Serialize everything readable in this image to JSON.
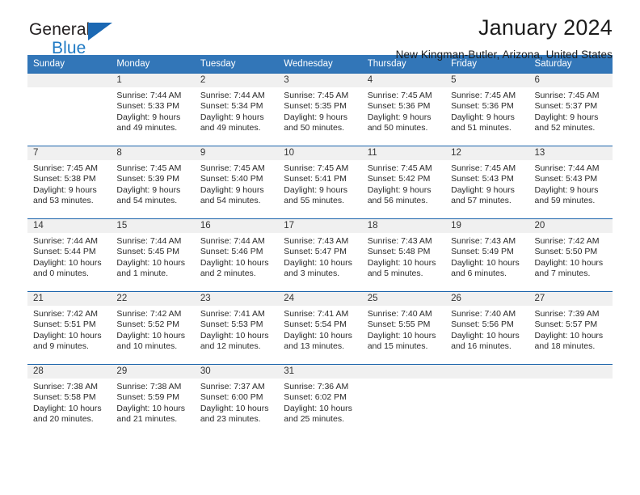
{
  "brand": {
    "name_part1": "General",
    "name_part2": "Blue",
    "logo_icon": "triangle-logo-icon"
  },
  "header": {
    "title": "January 2024",
    "location": "New Kingman-Butler, Arizona, United States"
  },
  "colors": {
    "header_blue": "#3276b8",
    "cell_top_border": "#1b64ab",
    "daynum_band": "#f0f0f0",
    "brand_blue": "#1f7ac4"
  },
  "weekdays": [
    "Sunday",
    "Monday",
    "Tuesday",
    "Wednesday",
    "Thursday",
    "Friday",
    "Saturday"
  ],
  "labels": {
    "sunrise_prefix": "Sunrise:",
    "sunset_prefix": "Sunset:",
    "daylight_prefix": "Daylight:"
  },
  "weeks": [
    [
      {
        "day": "",
        "empty": true,
        "line1": "",
        "line2": "",
        "line3": "",
        "line4": ""
      },
      {
        "day": "1",
        "line1": "Sunrise: 7:44 AM",
        "line2": "Sunset: 5:33 PM",
        "line3": "Daylight: 9 hours",
        "line4": "and 49 minutes."
      },
      {
        "day": "2",
        "line1": "Sunrise: 7:44 AM",
        "line2": "Sunset: 5:34 PM",
        "line3": "Daylight: 9 hours",
        "line4": "and 49 minutes."
      },
      {
        "day": "3",
        "line1": "Sunrise: 7:45 AM",
        "line2": "Sunset: 5:35 PM",
        "line3": "Daylight: 9 hours",
        "line4": "and 50 minutes."
      },
      {
        "day": "4",
        "line1": "Sunrise: 7:45 AM",
        "line2": "Sunset: 5:36 PM",
        "line3": "Daylight: 9 hours",
        "line4": "and 50 minutes."
      },
      {
        "day": "5",
        "line1": "Sunrise: 7:45 AM",
        "line2": "Sunset: 5:36 PM",
        "line3": "Daylight: 9 hours",
        "line4": "and 51 minutes."
      },
      {
        "day": "6",
        "line1": "Sunrise: 7:45 AM",
        "line2": "Sunset: 5:37 PM",
        "line3": "Daylight: 9 hours",
        "line4": "and 52 minutes."
      }
    ],
    [
      {
        "day": "7",
        "line1": "Sunrise: 7:45 AM",
        "line2": "Sunset: 5:38 PM",
        "line3": "Daylight: 9 hours",
        "line4": "and 53 minutes."
      },
      {
        "day": "8",
        "line1": "Sunrise: 7:45 AM",
        "line2": "Sunset: 5:39 PM",
        "line3": "Daylight: 9 hours",
        "line4": "and 54 minutes."
      },
      {
        "day": "9",
        "line1": "Sunrise: 7:45 AM",
        "line2": "Sunset: 5:40 PM",
        "line3": "Daylight: 9 hours",
        "line4": "and 54 minutes."
      },
      {
        "day": "10",
        "line1": "Sunrise: 7:45 AM",
        "line2": "Sunset: 5:41 PM",
        "line3": "Daylight: 9 hours",
        "line4": "and 55 minutes."
      },
      {
        "day": "11",
        "line1": "Sunrise: 7:45 AM",
        "line2": "Sunset: 5:42 PM",
        "line3": "Daylight: 9 hours",
        "line4": "and 56 minutes."
      },
      {
        "day": "12",
        "line1": "Sunrise: 7:45 AM",
        "line2": "Sunset: 5:43 PM",
        "line3": "Daylight: 9 hours",
        "line4": "and 57 minutes."
      },
      {
        "day": "13",
        "line1": "Sunrise: 7:44 AM",
        "line2": "Sunset: 5:43 PM",
        "line3": "Daylight: 9 hours",
        "line4": "and 59 minutes."
      }
    ],
    [
      {
        "day": "14",
        "line1": "Sunrise: 7:44 AM",
        "line2": "Sunset: 5:44 PM",
        "line3": "Daylight: 10 hours",
        "line4": "and 0 minutes."
      },
      {
        "day": "15",
        "line1": "Sunrise: 7:44 AM",
        "line2": "Sunset: 5:45 PM",
        "line3": "Daylight: 10 hours",
        "line4": "and 1 minute."
      },
      {
        "day": "16",
        "line1": "Sunrise: 7:44 AM",
        "line2": "Sunset: 5:46 PM",
        "line3": "Daylight: 10 hours",
        "line4": "and 2 minutes."
      },
      {
        "day": "17",
        "line1": "Sunrise: 7:43 AM",
        "line2": "Sunset: 5:47 PM",
        "line3": "Daylight: 10 hours",
        "line4": "and 3 minutes."
      },
      {
        "day": "18",
        "line1": "Sunrise: 7:43 AM",
        "line2": "Sunset: 5:48 PM",
        "line3": "Daylight: 10 hours",
        "line4": "and 5 minutes."
      },
      {
        "day": "19",
        "line1": "Sunrise: 7:43 AM",
        "line2": "Sunset: 5:49 PM",
        "line3": "Daylight: 10 hours",
        "line4": "and 6 minutes."
      },
      {
        "day": "20",
        "line1": "Sunrise: 7:42 AM",
        "line2": "Sunset: 5:50 PM",
        "line3": "Daylight: 10 hours",
        "line4": "and 7 minutes."
      }
    ],
    [
      {
        "day": "21",
        "line1": "Sunrise: 7:42 AM",
        "line2": "Sunset: 5:51 PM",
        "line3": "Daylight: 10 hours",
        "line4": "and 9 minutes."
      },
      {
        "day": "22",
        "line1": "Sunrise: 7:42 AM",
        "line2": "Sunset: 5:52 PM",
        "line3": "Daylight: 10 hours",
        "line4": "and 10 minutes."
      },
      {
        "day": "23",
        "line1": "Sunrise: 7:41 AM",
        "line2": "Sunset: 5:53 PM",
        "line3": "Daylight: 10 hours",
        "line4": "and 12 minutes."
      },
      {
        "day": "24",
        "line1": "Sunrise: 7:41 AM",
        "line2": "Sunset: 5:54 PM",
        "line3": "Daylight: 10 hours",
        "line4": "and 13 minutes."
      },
      {
        "day": "25",
        "line1": "Sunrise: 7:40 AM",
        "line2": "Sunset: 5:55 PM",
        "line3": "Daylight: 10 hours",
        "line4": "and 15 minutes."
      },
      {
        "day": "26",
        "line1": "Sunrise: 7:40 AM",
        "line2": "Sunset: 5:56 PM",
        "line3": "Daylight: 10 hours",
        "line4": "and 16 minutes."
      },
      {
        "day": "27",
        "line1": "Sunrise: 7:39 AM",
        "line2": "Sunset: 5:57 PM",
        "line3": "Daylight: 10 hours",
        "line4": "and 18 minutes."
      }
    ],
    [
      {
        "day": "28",
        "line1": "Sunrise: 7:38 AM",
        "line2": "Sunset: 5:58 PM",
        "line3": "Daylight: 10 hours",
        "line4": "and 20 minutes."
      },
      {
        "day": "29",
        "line1": "Sunrise: 7:38 AM",
        "line2": "Sunset: 5:59 PM",
        "line3": "Daylight: 10 hours",
        "line4": "and 21 minutes."
      },
      {
        "day": "30",
        "line1": "Sunrise: 7:37 AM",
        "line2": "Sunset: 6:00 PM",
        "line3": "Daylight: 10 hours",
        "line4": "and 23 minutes."
      },
      {
        "day": "31",
        "line1": "Sunrise: 7:36 AM",
        "line2": "Sunset: 6:02 PM",
        "line3": "Daylight: 10 hours",
        "line4": "and 25 minutes."
      },
      {
        "day": "",
        "empty": true,
        "line1": "",
        "line2": "",
        "line3": "",
        "line4": ""
      },
      {
        "day": "",
        "empty": true,
        "line1": "",
        "line2": "",
        "line3": "",
        "line4": ""
      },
      {
        "day": "",
        "empty": true,
        "line1": "",
        "line2": "",
        "line3": "",
        "line4": ""
      }
    ]
  ]
}
